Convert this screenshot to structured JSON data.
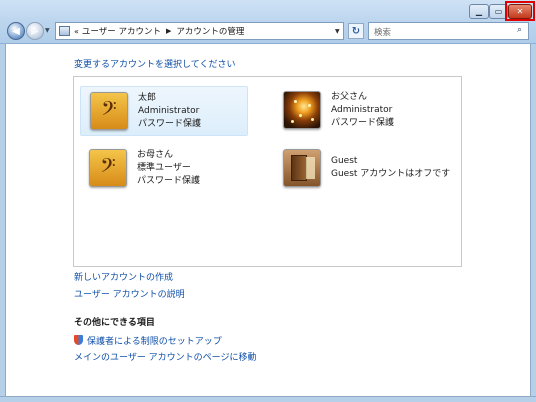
{
  "window": {
    "minimize_glyph": "▁",
    "maximize_glyph": "▭",
    "close_glyph": "✕"
  },
  "nav": {
    "back_glyph": "◀",
    "forward_glyph": "▶",
    "dropdown_glyph": "▼"
  },
  "address": {
    "overflow_glyph": "«",
    "crumbs": [
      "ユーザー アカウント",
      "アカウントの管理"
    ],
    "separator_glyph": "▶",
    "refresh_glyph": "↻"
  },
  "search": {
    "placeholder": "検索",
    "icon": "magnifier-icon"
  },
  "heading": "変更するアカウントを選択してください",
  "accounts": [
    {
      "name": "太郎",
      "type": "Administrator",
      "status": "パスワード保護",
      "picture": "guitar-clef"
    },
    {
      "name": "お父さん",
      "type": "Administrator",
      "status": "パスワード保護",
      "picture": "sparkle"
    },
    {
      "name": "お母さん",
      "type": "標準ユーザー",
      "status": "パスワード保護",
      "picture": "guitar-clef"
    },
    {
      "name": "Guest",
      "type": "Guest アカウントはオフです",
      "picture": "open-door"
    }
  ],
  "tasks": {
    "create": "新しいアカウントの作成",
    "explain": "ユーザー アカウントの説明"
  },
  "other": {
    "heading": "その他にできる項目",
    "parental": "保護者による制限のセットアップ",
    "main_page": "メインのユーザー アカウントのページに移動"
  },
  "colors": {
    "link": "#0f4fa8",
    "highlight": "#e00000"
  }
}
